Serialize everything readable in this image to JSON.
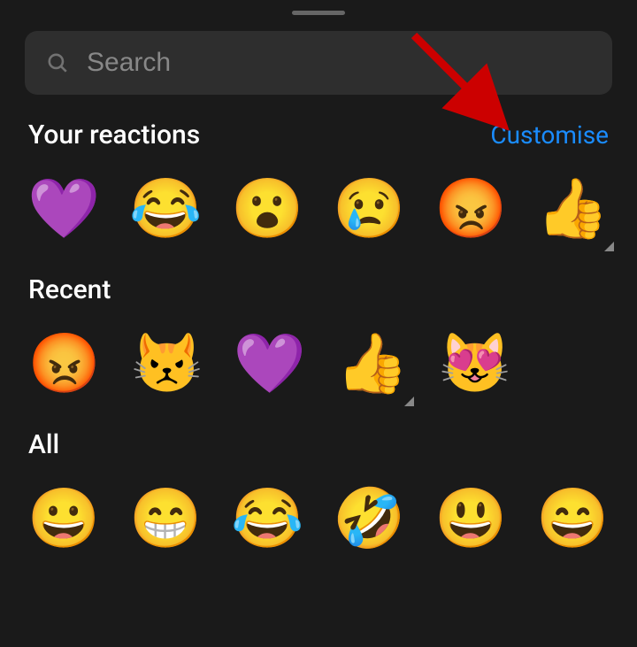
{
  "search": {
    "placeholder": "Search"
  },
  "sections": {
    "your_reactions": {
      "title": "Your reactions",
      "customise_label": "Customise",
      "items": [
        {
          "name": "purple-heart",
          "glyph": "💜",
          "tone": false
        },
        {
          "name": "face-with-tears-of-joy",
          "glyph": "😂",
          "tone": false
        },
        {
          "name": "face-with-open-mouth",
          "glyph": "😮",
          "tone": false
        },
        {
          "name": "crying-face",
          "glyph": "😢",
          "tone": false
        },
        {
          "name": "pouting-face",
          "glyph": "😡",
          "tone": false
        },
        {
          "name": "thumbs-up",
          "glyph": "👍",
          "tone": true
        }
      ]
    },
    "recent": {
      "title": "Recent",
      "items": [
        {
          "name": "pouting-face",
          "glyph": "😡",
          "tone": false
        },
        {
          "name": "pouting-cat",
          "glyph": "😾",
          "tone": false
        },
        {
          "name": "purple-heart",
          "glyph": "💜",
          "tone": false
        },
        {
          "name": "thumbs-up",
          "glyph": "👍",
          "tone": true
        },
        {
          "name": "smiling-cat-heart-eyes",
          "glyph": "😻",
          "tone": false
        }
      ]
    },
    "all": {
      "title": "All",
      "items": [
        {
          "name": "grinning-face",
          "glyph": "😀",
          "tone": false
        },
        {
          "name": "beaming-face",
          "glyph": "😁",
          "tone": false
        },
        {
          "name": "face-with-tears-of-joy",
          "glyph": "😂",
          "tone": false
        },
        {
          "name": "rolling-on-floor-laughing",
          "glyph": "🤣",
          "tone": false
        },
        {
          "name": "grinning-big-eyes",
          "glyph": "😃",
          "tone": false
        },
        {
          "name": "grinning-smiling-eyes",
          "glyph": "😄",
          "tone": false
        }
      ]
    }
  },
  "annotation": {
    "arrow_color": "#cc0000"
  }
}
